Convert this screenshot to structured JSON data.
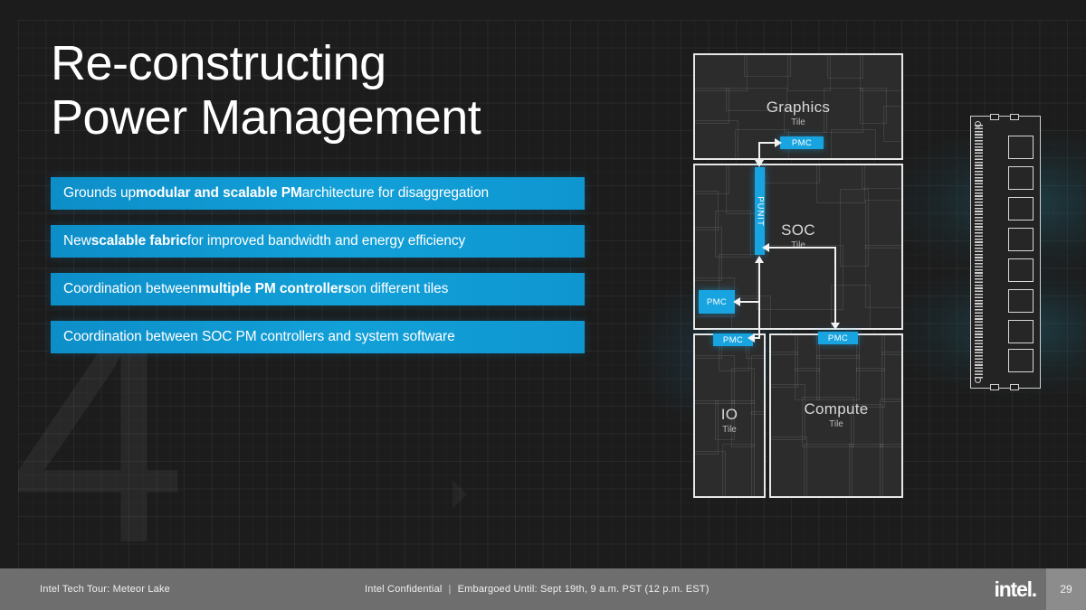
{
  "slide": {
    "title": "Re-constructing\nPower Management",
    "watermark_number": "4",
    "accent_color": "#12a0d8",
    "footer_bg": "#6e6e6e"
  },
  "bullets": [
    {
      "pre": "Grounds up ",
      "bold": "modular and scalable PM",
      "post": " architecture for disaggregation"
    },
    {
      "pre": "New ",
      "bold": "scalable fabric",
      "post": " for improved bandwidth and energy efficiency"
    },
    {
      "pre": "Coordination between ",
      "bold": "multiple PM controllers",
      "post": " on different tiles"
    },
    {
      "pre": "Coordination between SOC PM controllers and system software",
      "bold": "",
      "post": ""
    }
  ],
  "diagram": {
    "tiles": [
      {
        "name": "Graphics",
        "sub": "Tile"
      },
      {
        "name": "SOC",
        "sub": "Tile"
      },
      {
        "name": "IO",
        "sub": "Tile"
      },
      {
        "name": "Compute",
        "sub": "Tile"
      }
    ],
    "pmc_label": "PMC",
    "punit_label": "PUNIT",
    "pmc_count": 4
  },
  "memory": {
    "label": "DIMM",
    "chip_count": 8
  },
  "footer": {
    "left": "Intel Tech Tour: Meteor Lake",
    "confidential": "Intel Confidential",
    "separator": "|",
    "embargo": "Embargoed Until: Sept 19th, 9 a.m. PST (12 p.m. EST)",
    "logo": "intel",
    "logo_dot": ".",
    "page": "29"
  }
}
